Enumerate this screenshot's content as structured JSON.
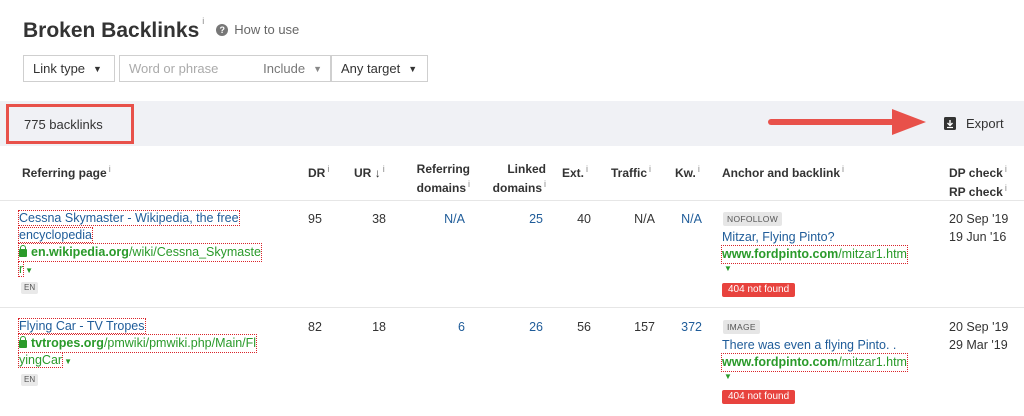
{
  "header": {
    "title": "Broken Backlinks",
    "title_info": "i",
    "howto_icon": "?",
    "howto_label": "How to use"
  },
  "filters": {
    "link_type": "Link type",
    "phrase_placeholder": "Word or phrase",
    "include": "Include",
    "any_target": "Any target"
  },
  "summary": {
    "count_label": "775 backlinks",
    "export_label": "Export",
    "highlight_color": "#e8514a"
  },
  "columns": {
    "referring_page": "Referring page",
    "dr": "DR",
    "ur": "UR",
    "ur_sort": "↓",
    "referring_domains_1": "Referring",
    "referring_domains_2": "domains",
    "linked_domains_1": "Linked",
    "linked_domains_2": "domains",
    "ext": "Ext.",
    "traffic": "Traffic",
    "kw": "Kw.",
    "anchor": "Anchor and backlink",
    "dp_check": "DP check",
    "rp_check": "RP check",
    "info": "i"
  },
  "rows": [
    {
      "title_line1": "Cessna Skymaster - Wikipedia, the free",
      "title_line2": "encyclopedia",
      "domain": "en.wikipedia.org",
      "path_line1": "/wiki/Cessna_Skymaste",
      "path_line2": "r",
      "lang": "EN",
      "dr": "95",
      "ur": "38",
      "referring_domains": "N/A",
      "linked_domains": "25",
      "ext": "40",
      "traffic": "N/A",
      "kw": "N/A",
      "tag": "NOFOLLOW",
      "anchor": "Mitzar, Flying Pinto?",
      "backlink_domain": "www.fordpinto.com",
      "backlink_path": "/mitzar1.htm",
      "status": "404 not found",
      "dp_check": "20 Sep '19",
      "rp_check": "19 Jun '16"
    },
    {
      "title_line1": "Flying Car - TV Tropes",
      "domain": "tvtropes.org",
      "path_line1": "/pmwiki/pmwiki.php/Main/Fl",
      "path_line2": "yingCar",
      "lang": "EN",
      "dr": "82",
      "ur": "18",
      "referring_domains": "6",
      "linked_domains": "26",
      "ext": "56",
      "traffic": "157",
      "kw": "372",
      "tag": "IMAGE",
      "anchor": "There was even a flying Pinto. .",
      "backlink_domain": "www.fordpinto.com",
      "backlink_path": "/mitzar1.htm",
      "status": "404 not found",
      "dp_check": "20 Sep '19",
      "rp_check": "29 Mar '19"
    }
  ],
  "icons": [
    "help-icon",
    "chevron-down-icon",
    "export-icon",
    "lock-icon",
    "arrow-right-icon"
  ]
}
